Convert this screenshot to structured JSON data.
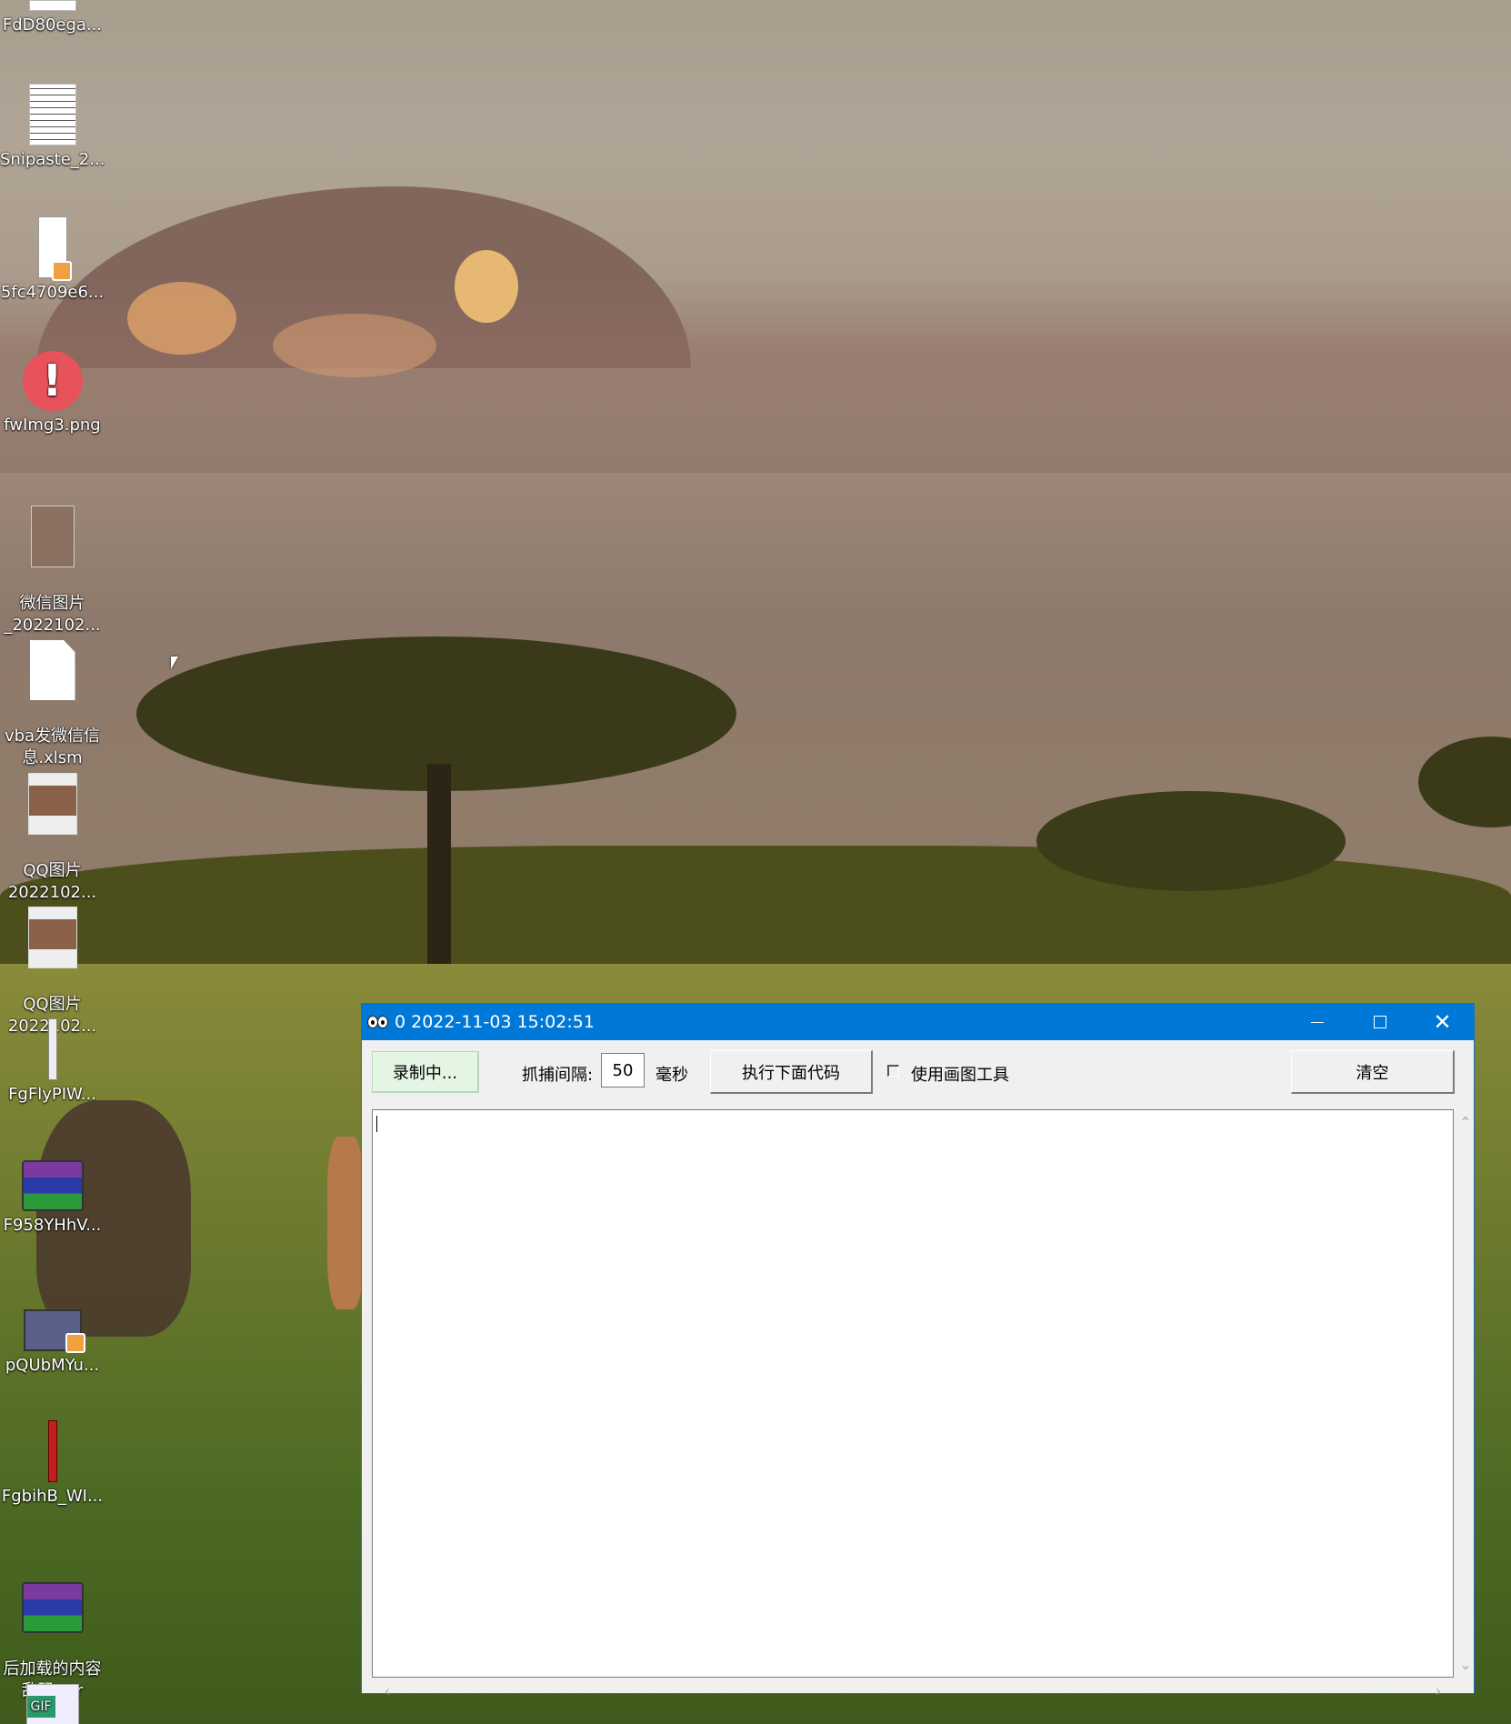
{
  "desktop": {
    "icons": [
      {
        "label": "FdD80ega...",
        "type": "document"
      },
      {
        "label": "Snipaste_2...",
        "type": "document"
      },
      {
        "label": "5fc4709e6...",
        "type": "video"
      },
      {
        "label": "fwImg3.png",
        "type": "error-image"
      },
      {
        "label": "微信图片\n_2022102...",
        "type": "photo"
      },
      {
        "label": "vba发微信信\n息.xlsm",
        "type": "blank-file"
      },
      {
        "label": "QQ图片\n2022102...",
        "type": "photo"
      },
      {
        "label": "QQ图片\n2022102...",
        "type": "photo"
      },
      {
        "label": "FgFlyPIW...",
        "type": "image"
      },
      {
        "label": "F958YHhV...",
        "type": "rar"
      },
      {
        "label": "pQUbMYu...",
        "type": "video"
      },
      {
        "label": "FgbihB_WI...",
        "type": "image"
      },
      {
        "label": "后加载的内容\n乱码.rar",
        "type": "rar"
      },
      {
        "label": "GIF",
        "type": "gif"
      }
    ]
  },
  "window": {
    "title": "0 2022-11-03 15:02:51",
    "controls": {
      "minimize": "—",
      "maximize": "☐",
      "close": "✕"
    },
    "toolbar": {
      "record_button": "录制中...",
      "interval_label": "抓捕间隔:",
      "interval_value": "50",
      "interval_unit": "毫秒",
      "exec_button": "执行下面代码",
      "use_paint_label": "使用画图工具",
      "use_paint_checked": false,
      "clear_button": "清空"
    },
    "editor": {
      "content": "",
      "scroll_up": "⌃",
      "scroll_down": "⌄",
      "scroll_left": "‹",
      "scroll_right": "›"
    }
  },
  "colors": {
    "titlebar": "#0078d7",
    "record_button_bg": "#e4f5e4"
  }
}
